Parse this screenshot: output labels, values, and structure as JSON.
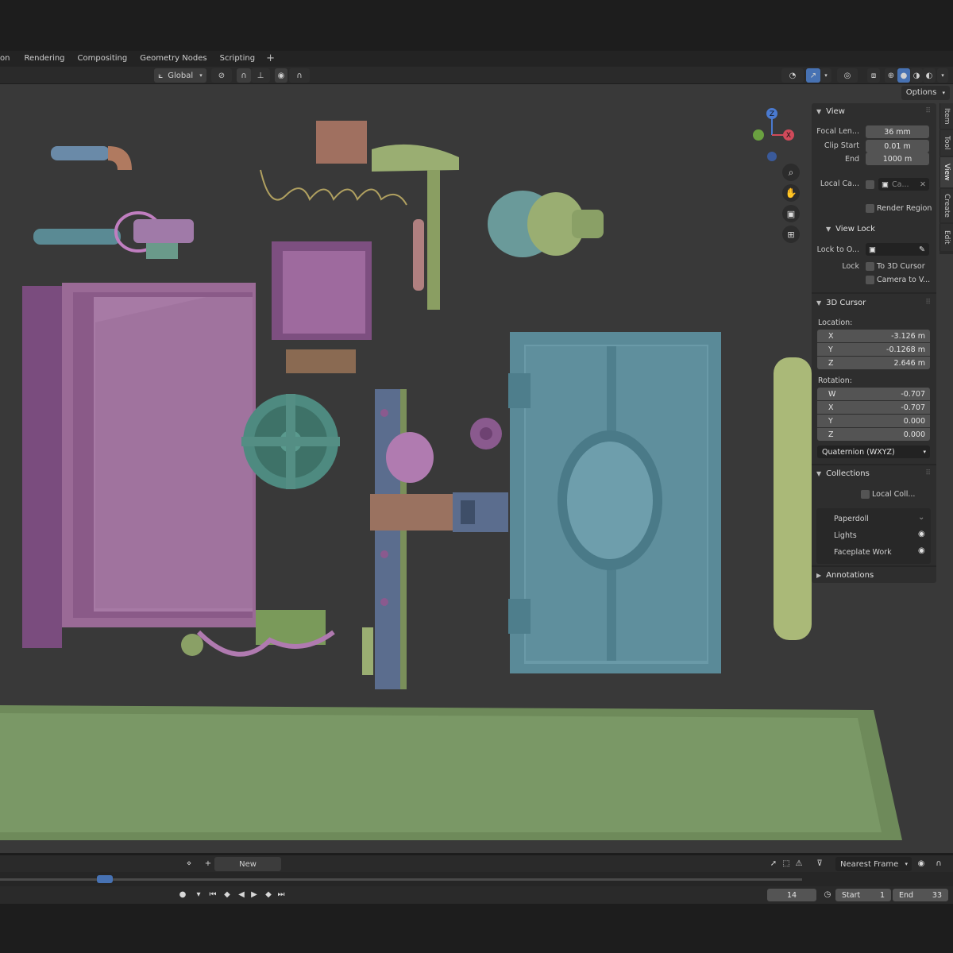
{
  "workspace_tabs": [
    "on",
    "Rendering",
    "Compositing",
    "Geometry Nodes",
    "Scripting"
  ],
  "workspace_add": "+",
  "header": {
    "transform_orientation": "Global"
  },
  "viewport": {
    "options_label": "Options",
    "gizmo_axes": {
      "z": "Z",
      "x": "X"
    }
  },
  "sidetabs": [
    "Item",
    "Tool",
    "View",
    "Create",
    "Edit"
  ],
  "view_panel": {
    "title": "View",
    "focal_label": "Focal Len...",
    "focal_value": "36 mm",
    "clip_start_label": "Clip Start",
    "clip_start_value": "0.01 m",
    "end_label": "End",
    "end_value": "1000 m",
    "local_camera_label": "Local Ca...",
    "local_camera_value": "Ca...",
    "render_region_label": "Render Region",
    "view_lock_title": "View Lock",
    "lock_to_object_label": "Lock to O...",
    "lock_label": "Lock",
    "to_3d_cursor_label": "To 3D Cursor",
    "camera_to_view_label": "Camera to V..."
  },
  "cursor_panel": {
    "title": "3D Cursor",
    "location_label": "Location:",
    "loc_x_label": "X",
    "loc_x": "-3.126 m",
    "loc_y_label": "Y",
    "loc_y": "-0.1268 m",
    "loc_z_label": "Z",
    "loc_z": "2.646 m",
    "rotation_label": "Rotation:",
    "rot_w_label": "W",
    "rot_w": "-0.707",
    "rot_x_label": "X",
    "rot_x": "-0.707",
    "rot_y_label": "Y",
    "rot_y": "0.000",
    "rot_z_label": "Z",
    "rot_z": "0.000",
    "rotation_mode": "Quaternion (WXYZ)"
  },
  "collections_panel": {
    "title": "Collections",
    "local_collections_label": "Local Coll...",
    "items": [
      "Paperdoll",
      "Lights",
      "Faceplate Work"
    ]
  },
  "annotations_panel": {
    "title": "Annotations"
  },
  "timeline": {
    "new_label": "New",
    "snap_mode": "Nearest Frame",
    "current_frame": "14",
    "start_label": "Start",
    "start_value": "1",
    "end_label": "End",
    "end_value": "33"
  },
  "colors": {
    "viewport_bg": "#393939",
    "panel_bg": "#2e2e2e",
    "field_bg": "#545454",
    "accent_blue": "#4772b3",
    "model_purple": "#8a5a8e",
    "model_teal": "#5a8a94",
    "model_green": "#7a8f5a"
  }
}
